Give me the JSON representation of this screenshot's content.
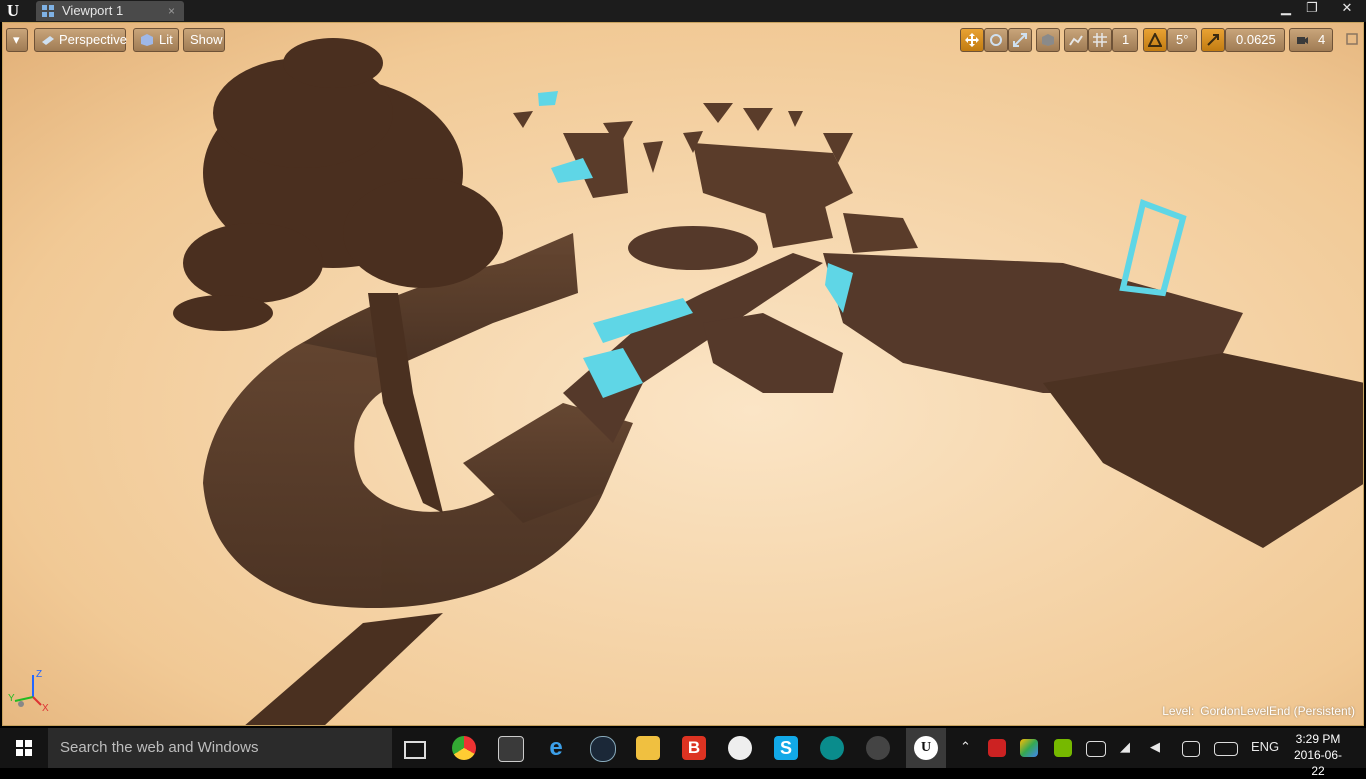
{
  "window": {
    "tab_title": "Viewport 1",
    "tab_close": "×",
    "controls": {
      "minimize": "▁",
      "restore": "❐",
      "close": "✕"
    }
  },
  "toolbar": {
    "menu_caret": "▾",
    "perspective_label": "Perspective",
    "lit_label": "Lit",
    "show_label": "Show",
    "grid_snap_value": "1",
    "rotation_snap_value": "5°",
    "scale_snap_value": "0.0625",
    "camera_speed_value": "4"
  },
  "axes": {
    "z": "Z",
    "y": "Y",
    "x": "X"
  },
  "level": {
    "prefix": "Level:",
    "name": "GordonLevelEnd (Persistent)"
  },
  "taskbar": {
    "search_placeholder": "Search the web and Windows",
    "lang": "ENG",
    "time": "3:29 PM",
    "date": "2016-06-22"
  },
  "colors": {
    "accent_orange": "#e39a2a",
    "sky_light": "#fbe3c4",
    "sky_dark": "#e3b37c",
    "structure": "#4f3424",
    "cyan_glow": "#5fd6e6"
  }
}
